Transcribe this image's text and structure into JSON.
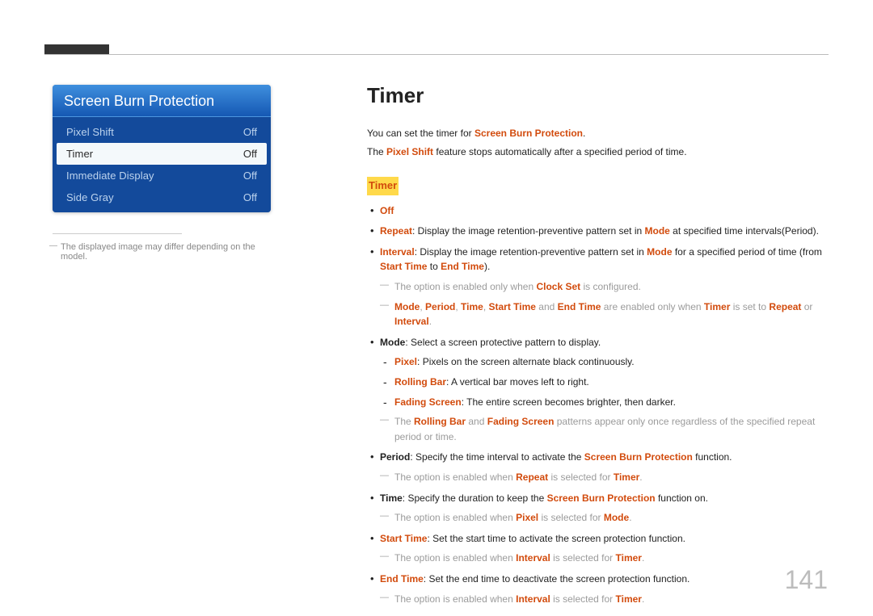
{
  "page_number": "141",
  "menu": {
    "title": "Screen Burn Protection",
    "rows": [
      {
        "label": "Pixel Shift",
        "value": "Off",
        "selected": false
      },
      {
        "label": "Timer",
        "value": "Off",
        "selected": true
      },
      {
        "label": "Immediate Display",
        "value": "Off",
        "selected": false
      },
      {
        "label": "Side Gray",
        "value": "Off",
        "selected": false
      }
    ]
  },
  "left_footnote": "The displayed image may differ depending on the model.",
  "heading": "Timer",
  "intro_line1_pre": "You can set the timer for ",
  "intro_line1_kw": "Screen Burn Protection",
  "intro_line1_post": ".",
  "intro_line2_pre": "The ",
  "intro_line2_kw": "Pixel Shift",
  "intro_line2_post": " feature stops automatically after a specified period of time.",
  "sub_heading": "Timer",
  "bul_off": "Off",
  "bul_repeat_kw": "Repeat",
  "bul_repeat_txt": ": Display the image retention-preventive pattern set in ",
  "bul_repeat_kw2": "Mode",
  "bul_repeat_txt2": " at specified time intervals(Period).",
  "bul_interval_kw": "Interval",
  "bul_interval_txt": ": Display the image retention-preventive pattern set in ",
  "bul_interval_kw2": "Mode",
  "bul_interval_txt2": " for a specified period of time (from ",
  "bul_interval_kw3": "Start Time",
  "bul_interval_txt3": " to ",
  "bul_interval_kw4": "End Time",
  "bul_interval_txt4": ").",
  "note_clockset_pre": "The option is enabled only when ",
  "note_clockset_kw": "Clock Set",
  "note_clockset_post": " is configured.",
  "note_fields_kw1": "Mode",
  "note_fields_kw2": "Period",
  "note_fields_kw3": "Time",
  "note_fields_kw4": "Start Time",
  "note_fields_and": " and ",
  "note_fields_kw5": "End Time",
  "note_fields_mid": " are enabled only when ",
  "note_fields_kw6": "Timer",
  "note_fields_mid2": " is set to ",
  "note_fields_kw7": "Repeat",
  "note_fields_or": " or ",
  "note_fields_kw8": "Interval",
  "bul_mode_kw": "Mode",
  "bul_mode_txt": ": Select a screen protective pattern to display.",
  "sub_pixel_kw": "Pixel",
  "sub_pixel_txt": ": Pixels on the screen alternate black continuously.",
  "sub_roll_kw": "Rolling Bar",
  "sub_roll_txt": ": A vertical bar moves left to right.",
  "sub_fade_kw": "Fading Screen",
  "sub_fade_txt": ": The entire screen becomes brighter, then darker.",
  "note_patterns_pre": "The ",
  "note_patterns_kw1": "Rolling Bar",
  "note_patterns_mid": " and ",
  "note_patterns_kw2": "Fading Screen",
  "note_patterns_post": " patterns appear only once regardless of the specified repeat period or time.",
  "bul_period_kw": "Period",
  "bul_period_txt": ": Specify the time interval to activate the ",
  "bul_period_kw2": "Screen Burn Protection",
  "bul_period_txt2": " function.",
  "note_period_pre": "The option is enabled when ",
  "note_period_kw": "Repeat",
  "note_period_mid": " is selected for ",
  "note_period_kw2": "Timer",
  "bul_time_kw": "Time",
  "bul_time_txt": ": Specify the duration to keep the ",
  "bul_time_kw2": "Screen Burn Protection",
  "bul_time_txt2": " function on.",
  "note_time_pre": "The option is enabled when ",
  "note_time_kw": "Pixel",
  "note_time_mid": " is selected for ",
  "note_time_kw2": "Mode",
  "bul_start_kw": "Start Time",
  "bul_start_txt": ": Set the start time to activate the screen protection function.",
  "note_start_pre": "The option is enabled when ",
  "note_start_kw": "Interval",
  "note_start_mid": " is selected for ",
  "note_start_kw2": "Timer",
  "bul_end_kw": "End Time",
  "bul_end_txt": ": Set the end time to deactivate the screen protection function.",
  "note_end_pre": "The option is enabled when ",
  "note_end_kw": "Interval",
  "note_end_mid": " is selected for ",
  "note_end_kw2": "Timer",
  "sep_comma": ", ",
  "period": "."
}
